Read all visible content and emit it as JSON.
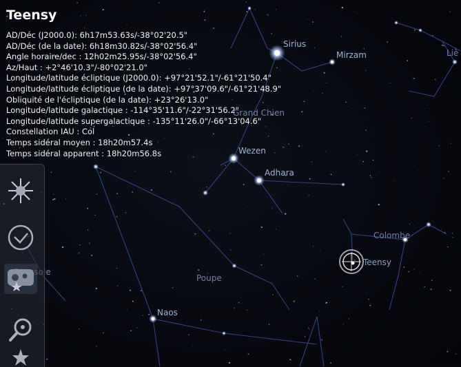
{
  "object": {
    "name": "Teensy",
    "lines": [
      "AD/Déc (J2000.0): 6h17m53.63s/-38°02'20.5\"",
      "AD/Déc (de la date): 6h18m30.82s/-38°02'56.4\"",
      "Angle horaire/dec : 12h02m25.95s/-38°02'56.4\"",
      "Az/Haut : +2°46'10.3\"/-80°02'21.0\"",
      "Longitude/latitude écliptique (J2000.0): +97°21'52.1\"/-61°21'50.4\"",
      "Longitude/latitude écliptique (de la date): +97°37'09.6\"/-61°21'48.9\"",
      "Obliquité de l'écliptique (de la date): +23°26'13.0\"",
      "Longitude/latitude galactique : -114°35'11.6\"/-22°31'56.2\"",
      "Longitude/latitude supergalactique : -135°11'26.0\"/-66°13'04.6\"",
      "Constellation IAU : Col",
      "Temps sidéral moyen : 18h20m57.4s",
      "Temps sidéral apparent : 18h20m56.8s"
    ]
  },
  "sky_labels": {
    "sirius": "Sirius",
    "mirzam": "Mirzam",
    "grand_chien": "Grand Chien",
    "wezen": "Wezen",
    "adhara": "Adhara",
    "colombe": "Colombe",
    "teensy": "Teensy",
    "poupe": "Poupe",
    "naos": "Naos",
    "boussole": "Boussole",
    "lievre": "Liè"
  },
  "sidebar": {
    "buttons": [
      {
        "icon": "starburst-icon"
      },
      {
        "icon": "clock-icon"
      },
      {
        "icon": "sky-view-icon"
      },
      {
        "icon": "search-icon"
      },
      {
        "icon": "star-icon"
      }
    ]
  },
  "colors": {
    "background": "#05070c",
    "constellation_lines": "#3a4d85",
    "star_labels": "#9fb3d6",
    "info_text": "#ffffff"
  }
}
